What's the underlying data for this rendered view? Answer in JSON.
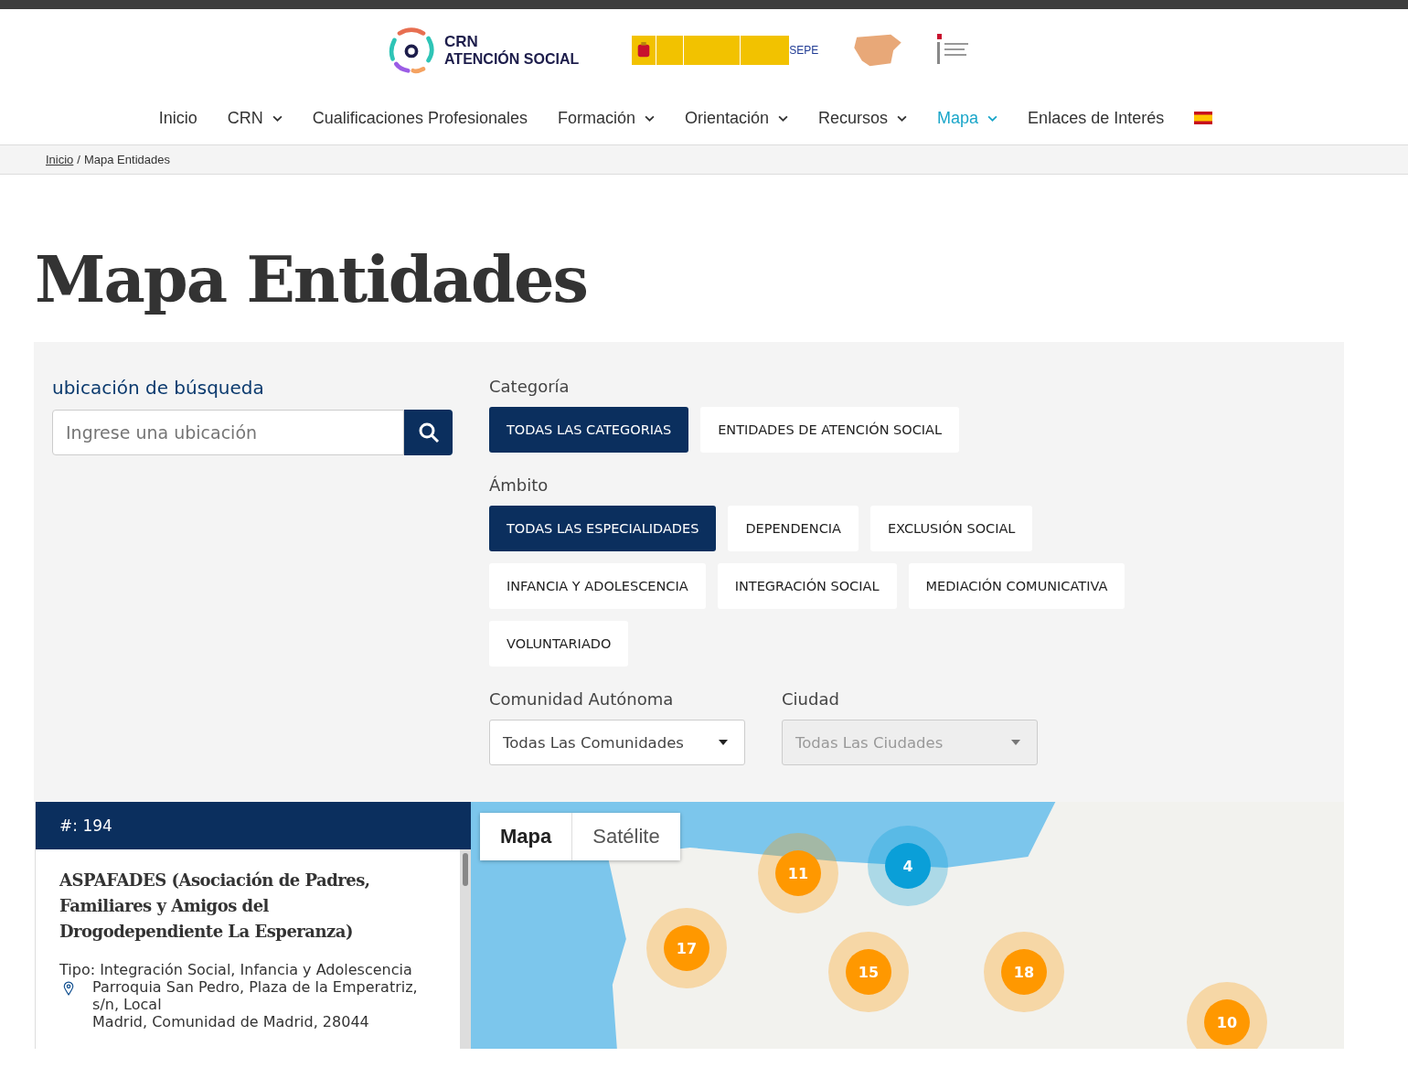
{
  "header": {
    "logo": {
      "line_1": "CRN",
      "line_2": "ATENCIÓN SOCIAL"
    },
    "partner_logos": {
      "sepe": "SEPE"
    }
  },
  "nav": [
    {
      "label": "Inicio",
      "has_menu": false,
      "selected": false
    },
    {
      "label": "CRN",
      "has_menu": true,
      "selected": false
    },
    {
      "label": "Cualificaciones Profesionales",
      "has_menu": false,
      "selected": false
    },
    {
      "label": "Formación",
      "has_menu": true,
      "selected": false
    },
    {
      "label": "Orientación",
      "has_menu": true,
      "selected": false
    },
    {
      "label": "Recursos",
      "has_menu": true,
      "selected": false
    },
    {
      "label": "Mapa",
      "has_menu": true,
      "selected": true
    },
    {
      "label": "Enlaces de Interés",
      "has_menu": false,
      "selected": false
    }
  ],
  "breadcrumb": {
    "link": "Inicio",
    "separator": "/",
    "current": "Mapa Entidades"
  },
  "title": "Mapa Entidades",
  "search": {
    "label": "ubicación de búsqueda",
    "placeholder": "Ingrese una ubicación"
  },
  "categoria": {
    "label": "Categoría",
    "options": [
      {
        "label": "TODAS LAS CATEGORIAS",
        "selected": true
      },
      {
        "label": "ENTIDADES DE ATENCIÓN SOCIAL",
        "selected": false
      }
    ]
  },
  "ambito": {
    "label": "Ámbito",
    "options": [
      {
        "label": "TODAS LAS ESPECIALIDADES",
        "selected": true
      },
      {
        "label": "DEPENDENCIA",
        "selected": false
      },
      {
        "label": "EXCLUSIÓN SOCIAL",
        "selected": false
      },
      {
        "label": "INFANCIA Y ADOLESCENCIA",
        "selected": false
      },
      {
        "label": "INTEGRACIÓN SOCIAL",
        "selected": false
      },
      {
        "label": "MEDIACIÓN COMUNICATIVA",
        "selected": false
      },
      {
        "label": "VOLUNTARIADO",
        "selected": false
      }
    ]
  },
  "comunidad": {
    "label": "Comunidad Autónoma",
    "value": "Todas Las Comunidades",
    "disabled": false
  },
  "ciudad": {
    "label": "Ciudad",
    "value": "Todas Las Ciudades",
    "disabled": true
  },
  "results": {
    "count": "#: 194",
    "entries": [
      {
        "name": "ASPAFADES (Asociación de Padres, Familiares y Amigos del Drogodependiente La Esperanza)",
        "type": "Tipo: Integración Social, Infancia y Adolescencia",
        "address": "Parroquia San Pedro, Plaza de la Emperatriz, s/n, Local",
        "city": "Madrid, Comunidad de Madrid, 28044"
      }
    ]
  },
  "map": {
    "tabs": [
      {
        "label": "Mapa",
        "selected": true
      },
      {
        "label": "Satélite",
        "selected": false
      }
    ],
    "clusters": [
      {
        "count": "11",
        "color": "#ff9800"
      },
      {
        "count": "4",
        "color": "#0a9fd8"
      },
      {
        "count": "17",
        "color": "#ff9800"
      },
      {
        "count": "15",
        "color": "#ff9800"
      },
      {
        "count": "18",
        "color": "#ff9800"
      },
      {
        "count": "10",
        "color": "#ff9800"
      }
    ]
  }
}
